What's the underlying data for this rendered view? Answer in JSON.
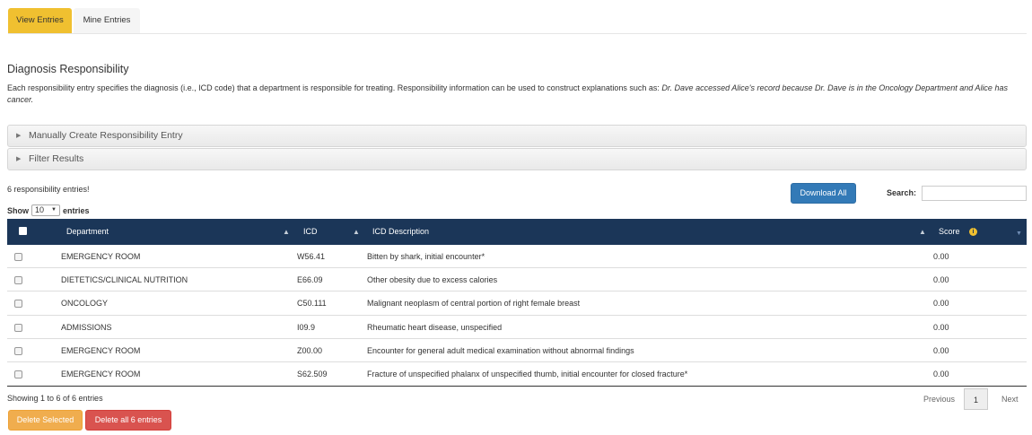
{
  "tabs": [
    {
      "label": "View Entries",
      "active": true
    },
    {
      "label": "Mine Entries",
      "active": false
    }
  ],
  "page": {
    "title": "Diagnosis Responsibility",
    "description_prefix": "Each responsibility entry specifies the diagnosis (i.e., ICD code) that a department is responsible for treating. Responsibility information can be used to construct explanations such as: ",
    "description_example": "Dr. Dave accessed Alice's record because Dr. Dave is in the Oncology Department and Alice has cancer."
  },
  "accordions": {
    "create": "Manually Create Responsibility Entry",
    "filter": "Filter Results"
  },
  "summary": {
    "count_text": "6 responsibility entries!",
    "show_label": "Show",
    "show_value": "10",
    "entries_label": "entries",
    "download_label": "Download All",
    "search_label": "Search:",
    "search_value": ""
  },
  "table": {
    "headers": {
      "department": "Department",
      "icd": "ICD",
      "icd_description": "ICD Description",
      "score": "Score"
    },
    "rows": [
      {
        "department": "EMERGENCY ROOM",
        "icd": "W56.41",
        "description": "Bitten by shark, initial encounter*",
        "score": "0.00"
      },
      {
        "department": "DIETETICS/CLINICAL NUTRITION",
        "icd": "E66.09",
        "description": "Other obesity due to excess calories",
        "score": "0.00"
      },
      {
        "department": "ONCOLOGY",
        "icd": "C50.111",
        "description": "Malignant neoplasm of central portion of right female breast",
        "score": "0.00"
      },
      {
        "department": "ADMISSIONS",
        "icd": "I09.9",
        "description": "Rheumatic heart disease, unspecified",
        "score": "0.00"
      },
      {
        "department": "EMERGENCY ROOM",
        "icd": "Z00.00",
        "description": "Encounter for general adult medical examination without abnormal findings",
        "score": "0.00"
      },
      {
        "department": "EMERGENCY ROOM",
        "icd": "S62.509",
        "description": "Fracture of unspecified phalanx of unspecified thumb, initial encounter for closed fracture*",
        "score": "0.00"
      }
    ]
  },
  "footer": {
    "showing_text": "Showing 1 to 6 of 6 entries",
    "prev_label": "Previous",
    "page_number": "1",
    "next_label": "Next",
    "delete_selected_label": "Delete Selected",
    "delete_all_label": "Delete all 6 entries"
  },
  "colors": {
    "active_tab": "#f0c030",
    "table_header": "#1b3658",
    "primary_button": "#337ab7",
    "warning_button": "#f0ad4e",
    "danger_button": "#d9534f",
    "info_icon": "#f0c030"
  },
  "icons": {
    "sort": "sort-arrows-icon",
    "info": "info-circle-icon",
    "accordion": "caret-right-icon"
  }
}
